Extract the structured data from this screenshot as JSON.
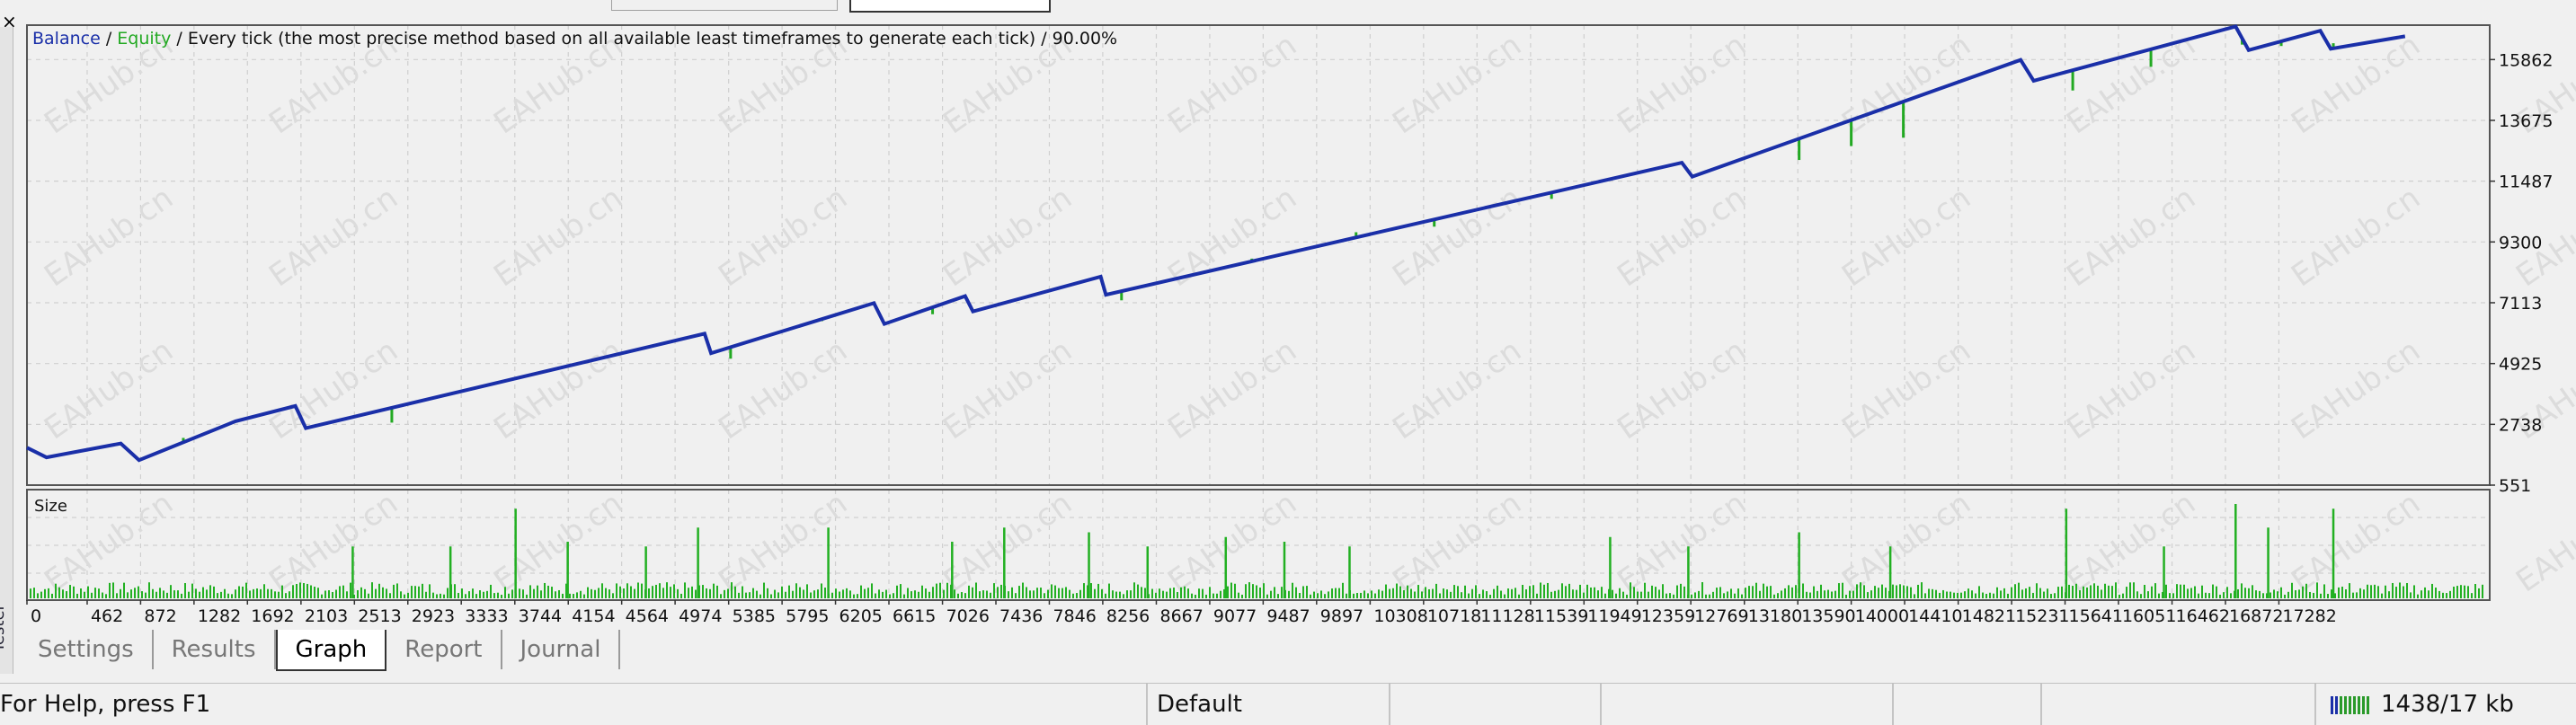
{
  "window": {
    "side_label": "Tester"
  },
  "chart_header": {
    "balance": "Balance",
    "sep1": " / ",
    "equity": "Equity",
    "rest": " / Every tick (the most precise method based on all available least timeframes to generate each tick) / 90.00%"
  },
  "colors": {
    "balance": "#1a2fa8",
    "equity": "#22a922",
    "size_bars": "#22b022",
    "grid": "#cfcfcf",
    "watermark": "#dcdcdc"
  },
  "watermark": "EAHub.cn",
  "chart_data": [
    {
      "type": "line",
      "title": "",
      "series": [
        {
          "name": "Balance"
        },
        {
          "name": "Equity"
        }
      ],
      "y_ticks": [
        551,
        2738,
        4925,
        7113,
        9300,
        11487,
        13675,
        15862
      ],
      "ylim": [
        551,
        17100
      ],
      "xlim": [
        0,
        18900
      ],
      "balance_points": [
        [
          0,
          1900
        ],
        [
          150,
          1550
        ],
        [
          720,
          2050
        ],
        [
          860,
          1450
        ],
        [
          1600,
          2850
        ],
        [
          2060,
          3400
        ],
        [
          2140,
          2600
        ],
        [
          5200,
          6000
        ],
        [
          5250,
          5300
        ],
        [
          6500,
          7100
        ],
        [
          6580,
          6350
        ],
        [
          7200,
          7350
        ],
        [
          7260,
          6800
        ],
        [
          8240,
          8050
        ],
        [
          8280,
          7400
        ],
        [
          12700,
          12150
        ],
        [
          12780,
          11650
        ],
        [
          15300,
          15850
        ],
        [
          15400,
          15100
        ],
        [
          16950,
          17050
        ],
        [
          17050,
          16200
        ],
        [
          17600,
          16900
        ],
        [
          17680,
          16250
        ],
        [
          18250,
          16700
        ]
      ],
      "equity_dips": [
        [
          500,
          1900
        ],
        [
          1200,
          2250
        ],
        [
          2800,
          2800
        ],
        [
          5400,
          5100
        ],
        [
          6100,
          6450
        ],
        [
          6950,
          6700
        ],
        [
          8400,
          7200
        ],
        [
          9400,
          8700
        ],
        [
          10200,
          9650
        ],
        [
          10800,
          9850
        ],
        [
          11700,
          10850
        ],
        [
          12200,
          11650
        ],
        [
          13600,
          12250
        ],
        [
          14000,
          12750
        ],
        [
          14400,
          13050
        ],
        [
          15700,
          14750
        ],
        [
          16300,
          15600
        ],
        [
          17000,
          16400
        ],
        [
          17300,
          16350
        ],
        [
          17700,
          16450
        ]
      ]
    },
    {
      "type": "bar",
      "title": "Size",
      "x_ticks": [
        0,
        462,
        872,
        1282,
        1692,
        2103,
        2513,
        2923,
        3333,
        3744,
        4154,
        4564,
        4974,
        5385,
        5795,
        6205,
        6615,
        7026,
        7436,
        7846,
        8256,
        8667,
        9077,
        9487,
        9897,
        10308,
        10718,
        11128,
        11539,
        11949,
        12359,
        12769,
        13180,
        13590,
        14000,
        14410,
        14821,
        15231,
        15641,
        16051,
        16462,
        16872,
        17282
      ],
      "tall_bars": [
        [
          2500,
          0.55
        ],
        [
          3250,
          0.55
        ],
        [
          3750,
          0.95
        ],
        [
          4150,
          0.6
        ],
        [
          4750,
          0.55
        ],
        [
          5150,
          0.75
        ],
        [
          6150,
          0.75
        ],
        [
          7100,
          0.6
        ],
        [
          7500,
          0.75
        ],
        [
          8150,
          0.7
        ],
        [
          8600,
          0.55
        ],
        [
          9200,
          0.65
        ],
        [
          9650,
          0.6
        ],
        [
          10150,
          0.55
        ],
        [
          12150,
          0.65
        ],
        [
          12750,
          0.55
        ],
        [
          13600,
          0.7
        ],
        [
          14300,
          0.55
        ],
        [
          15650,
          0.95
        ],
        [
          16400,
          0.55
        ],
        [
          16950,
          1.0
        ],
        [
          17200,
          0.75
        ],
        [
          17700,
          0.95
        ]
      ]
    }
  ],
  "tabs": [
    {
      "label": "Settings"
    },
    {
      "label": "Results"
    },
    {
      "label": "Graph"
    },
    {
      "label": "Report"
    },
    {
      "label": "Journal"
    }
  ],
  "status": {
    "help": "For Help, press F1",
    "profile": "Default",
    "traffic": "1438/17 kb"
  }
}
